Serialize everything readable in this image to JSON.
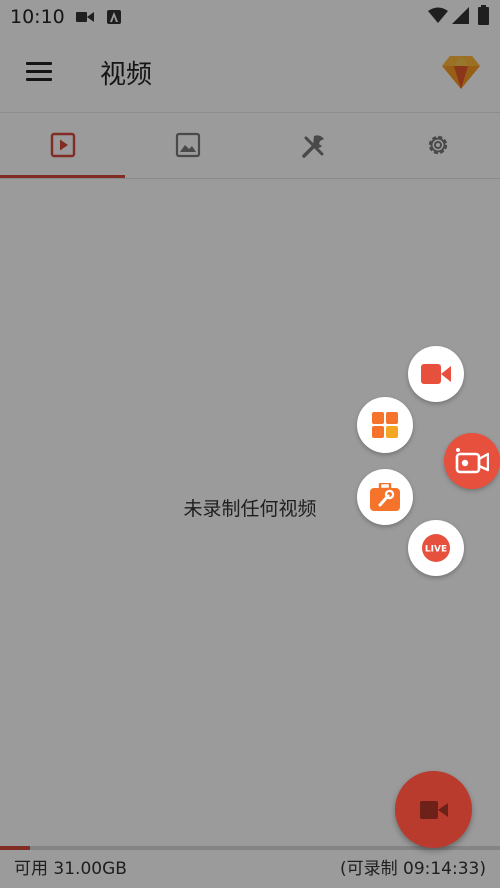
{
  "status_bar": {
    "time": "10:10",
    "left_icons": [
      "video-camera-icon",
      "a-notification-icon"
    ],
    "right_icons": [
      "wifi-icon",
      "signal-icon",
      "battery-icon"
    ]
  },
  "app_bar": {
    "title": "视频",
    "menu_icon": "menu-icon",
    "action_icon": "diamond-gem-icon"
  },
  "tabs": [
    {
      "name": "videos",
      "icon": "play-square-icon",
      "selected": true
    },
    {
      "name": "images",
      "icon": "image-icon",
      "selected": false
    },
    {
      "name": "tools",
      "icon": "tools-icon",
      "selected": false
    },
    {
      "name": "settings",
      "icon": "gear-icon",
      "selected": false
    }
  ],
  "empty_state": {
    "message": "未录制任何视频"
  },
  "floating_menu": {
    "items": [
      {
        "name": "record",
        "icon": "video-camera-icon"
      },
      {
        "name": "apps",
        "icon": "grid-icon"
      },
      {
        "name": "toolbox",
        "icon": "toolbox-icon"
      },
      {
        "name": "live",
        "icon": "live-icon",
        "label": "LIVE"
      }
    ],
    "main_icon": "camcorder-icon"
  },
  "fab": {
    "icon": "video-camera-icon"
  },
  "footer": {
    "available": "可用 31.00GB",
    "recordable": "(可录制 09:14:33)",
    "storage_used_fraction": 0.06
  },
  "colors": {
    "accent": "#d0493a",
    "bubble_accent": "#e8503e",
    "fab": "#b83b2d"
  }
}
